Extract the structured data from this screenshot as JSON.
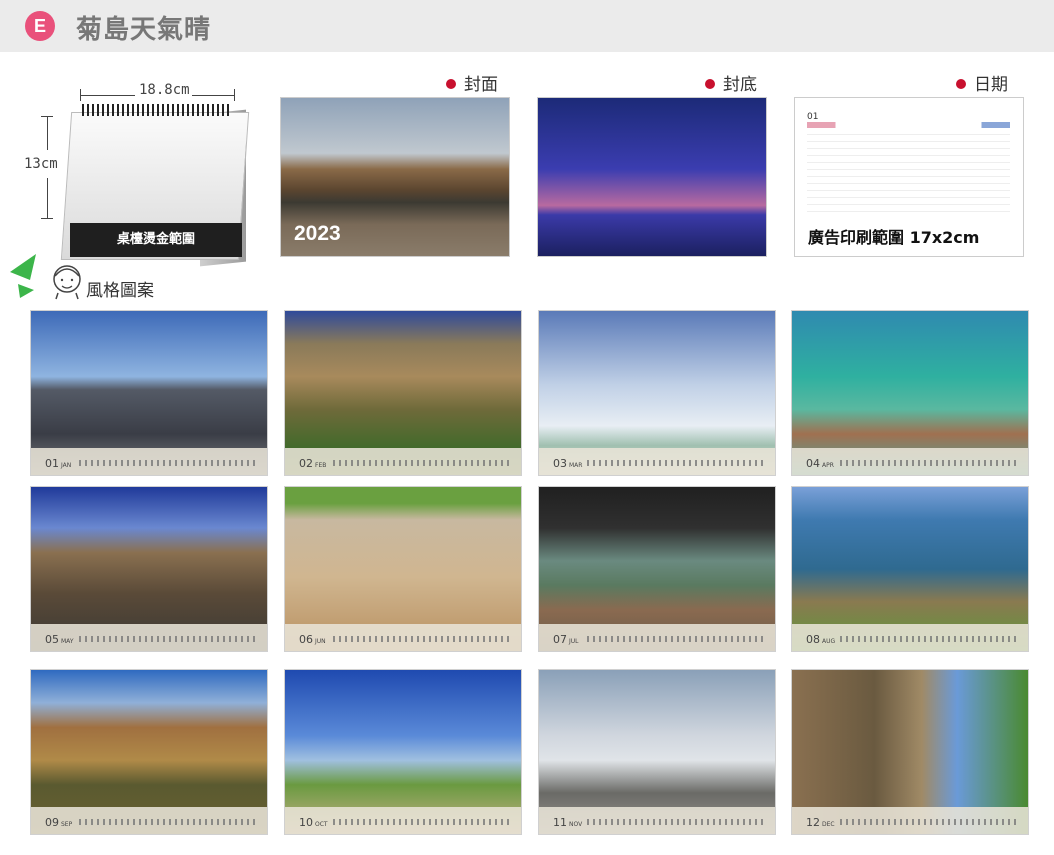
{
  "header": {
    "badge": "E",
    "title": "菊島天氣晴"
  },
  "mockup": {
    "width_label": "18.8cm",
    "height_label": "13cm",
    "strip_label": "桌檯燙金範圍"
  },
  "style_label": "風格圖案",
  "previews": {
    "cover": {
      "caption": "封面",
      "year": "2023"
    },
    "back": {
      "caption": "封底"
    },
    "date": {
      "caption": "日期",
      "ad_text": "廣告印刷範圍 17x2cm",
      "month_label": "01"
    }
  },
  "months": [
    {
      "num": "01",
      "abbr": "JAN"
    },
    {
      "num": "02",
      "abbr": "FEB"
    },
    {
      "num": "03",
      "abbr": "MAR"
    },
    {
      "num": "04",
      "abbr": "APR"
    },
    {
      "num": "05",
      "abbr": "MAY"
    },
    {
      "num": "06",
      "abbr": "JUN"
    },
    {
      "num": "07",
      "abbr": "JUL"
    },
    {
      "num": "08",
      "abbr": "AUG"
    },
    {
      "num": "09",
      "abbr": "SEP"
    },
    {
      "num": "10",
      "abbr": "OCT"
    },
    {
      "num": "11",
      "abbr": "NOV"
    },
    {
      "num": "12",
      "abbr": "DEC"
    }
  ]
}
